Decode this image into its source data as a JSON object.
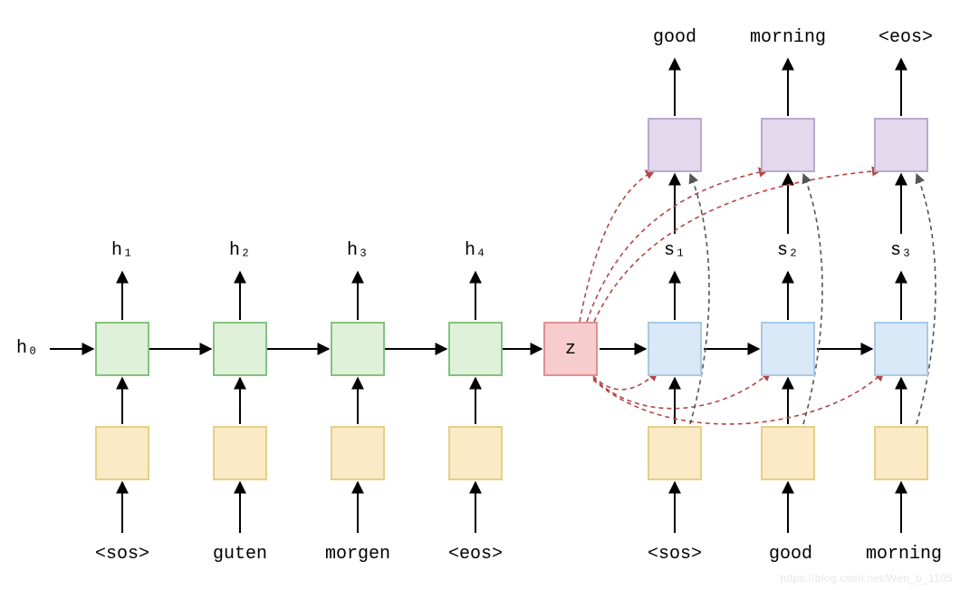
{
  "h0": "h₀",
  "encoder": {
    "hidden_labels": [
      "h₁",
      "h₂",
      "h₃",
      "h₄"
    ],
    "inputs": [
      "<sos>",
      "guten",
      "morgen",
      "<eos>"
    ]
  },
  "context": {
    "label": "z"
  },
  "decoder": {
    "state_labels": [
      "s₁",
      "s₂",
      "s₃"
    ],
    "inputs": [
      "<sos>",
      "good",
      "morning"
    ],
    "outputs": [
      "good",
      "morning",
      "<eos>"
    ]
  },
  "colors": {
    "encoder_cell": "#dff1d9",
    "embedding": "#fbeac5",
    "context": "#f6cccd",
    "decoder_cell": "#d9e9f7",
    "output_layer": "#e3d9ed"
  },
  "watermark": "https://blog.csdn.net/Wen_b_1105"
}
